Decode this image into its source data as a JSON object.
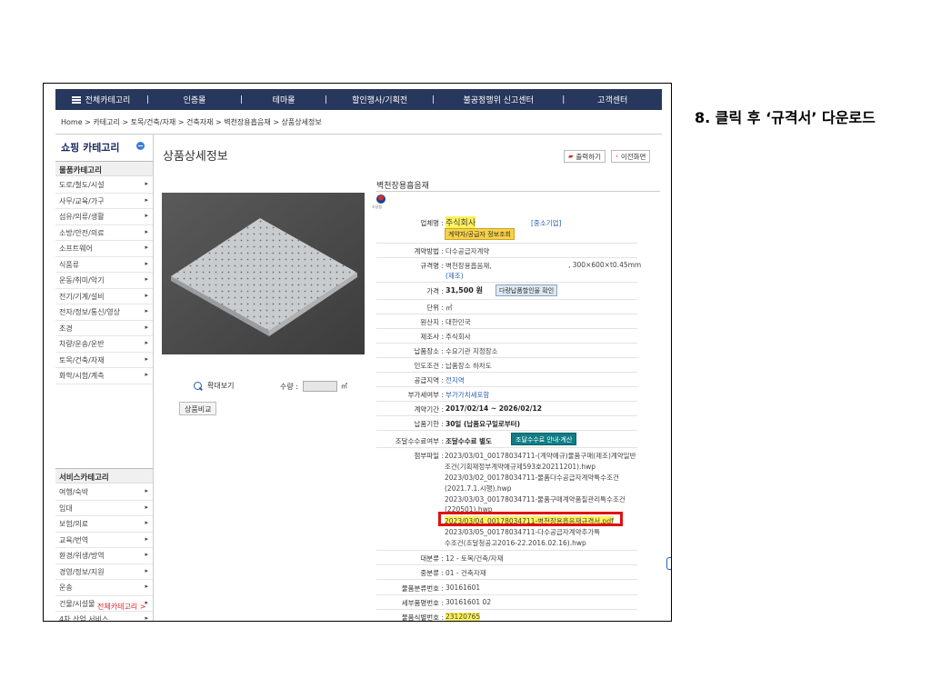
{
  "caption": "8. 클릭 후 ‘규격서’ 다운로드",
  "nav": {
    "items": [
      "전체카테고리",
      "인증몰",
      "테마몰",
      "할인행사/기획전",
      "불공정행위 신고센터",
      "고객센터"
    ],
    "separator": "|"
  },
  "breadcrumb": "Home > 카테고리 > 토목/건축/자재 > 건축자재 > 벽천장용흡음재 > 상품상세정보",
  "sidebar": {
    "title": "쇼핑 카테고리",
    "goods_header": "물품카테고리",
    "goods": [
      "도로/철도/시설",
      "사무/교육/가구",
      "섬유/의류/생활",
      "소방/안전/의료",
      "소프트웨어",
      "식품류",
      "운동/취미/악기",
      "전기/기계/설비",
      "전자/정보/통신/영상",
      "조경",
      "차량/운송/운반",
      "토목/건축/자재",
      "화학/시험/계측"
    ],
    "service_header": "서비스카테고리",
    "services": [
      "여행/숙박",
      "임대",
      "보험/의료",
      "교육/번역",
      "환경/위생/방역",
      "경영/정보/지원",
      "운송",
      "건물/시설물",
      "4차 산업 서비스"
    ],
    "all_link": "전체카테고리 >",
    "arrow": "▸"
  },
  "main": {
    "page_title": "상품상세정보",
    "print_button": "출력하기",
    "back_button": "이전화면",
    "print_icon": "printer-icon",
    "back_icon": "chevron-left-icon",
    "product_name": "벽천장용흡음재",
    "seal_text": "조달청",
    "zoom_label": "확대보기",
    "qty_label": "수량 :",
    "qty_unit": "㎡",
    "compare_button": "상품비교"
  },
  "spec": {
    "company_label": "업체명 :",
    "company_value": "주식회사",
    "company_tag": "[중소기업]",
    "contractor_button": "계약자/공급자 정보조회",
    "method_label": "계약방법 :",
    "method_value": "다수공급자계약",
    "spec_label": "규격명 :",
    "spec_value": "벽천장용흡음재,",
    "spec_dims": ", 300×600×t0.45mm",
    "spec_maker": "(제조)",
    "price_label": "가격 :",
    "price_value": "31,500 원",
    "discount_button": "다량납품할인율 확인",
    "unit_label": "단위 :",
    "unit_value": "㎡",
    "origin_label": "원산지 :",
    "origin_value": "대한민국",
    "maker_label": "제조사 :",
    "maker_value": "주식회사",
    "delivery_place_label": "납품장소 :",
    "delivery_place_value": "수요기관 지정장소",
    "delivery_cond_label": "인도조건 :",
    "delivery_cond_value": "납품장소 하차도",
    "region_label": "공급지역 :",
    "region_value": "전지역",
    "vat_label": "부가세여부 :",
    "vat_value": "부가가치세포함",
    "period_label": "계약기간 :",
    "period_value": "2017/02/14 ~ 2026/02/12",
    "due_label": "납품기한 :",
    "due_value": "30일 (납품요구일로부터)",
    "fee_label": "조달수수료여부 :",
    "fee_value": "조달수수료 별도",
    "fee_button": "조달수수료 안내·계산",
    "files_label": "첨부파일 :",
    "files": [
      "2023/03/01_00178034711-(계약예규)물품구매(제조)계약일반",
      "조건(기획재정부계약예규제593호20211201).hwp",
      "2023/03/02_00178034711-물품다수공급자계약특수조건",
      "(2021.7.1.시행).hwp",
      "2023/03/03_00178034711-물품구매계약품질관리특수조건",
      "(220501).hwp",
      "2023/03/04_00178034711-벽천장용흡음재규격서.pdf",
      "2023/03/05_00178034711-다수공급자계약추가특",
      "수조건(조달청공고2016-22.2016.02.16).hwp"
    ],
    "major_label": "대분류 :",
    "major_value": "12 - 토목/건축/자재",
    "middle_label": "중분류 :",
    "middle_value": "01 - 건축자재",
    "class_no_label": "물품분류번호 :",
    "class_no_value": "30161601",
    "detail_no_label": "세부품명번호 :",
    "detail_no_value": "30161601 02",
    "id_no_label": "물품식별번호 :",
    "id_no_value": "23120765"
  }
}
